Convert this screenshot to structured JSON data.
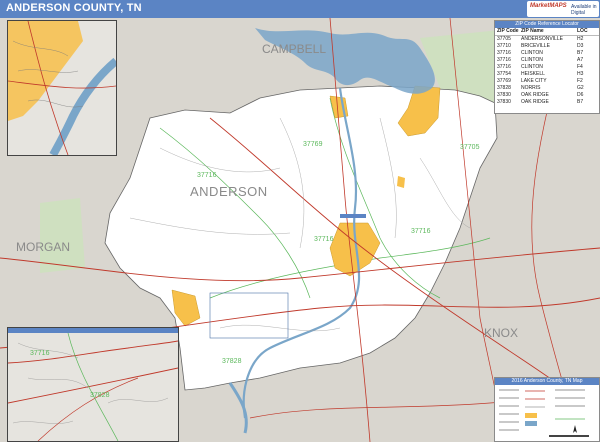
{
  "title": "ANDERSON COUNTY, TN",
  "logo": {
    "brand": "MarketMAPS",
    "sub": "Available in\nDigital"
  },
  "map_labels": {
    "county": "ANDERSON",
    "neighbors": [
      "CAMPBELL",
      "MORGAN",
      "KNOX"
    ],
    "zip_labels": [
      "37769",
      "37705",
      "37716",
      "37716",
      "37716",
      "37828"
    ],
    "inset_zip": [
      "37716",
      "37828"
    ]
  },
  "zip_table": {
    "heading": "ZIP Code Reference Locator",
    "columns": [
      "ZIP Code",
      "ZIP Name",
      "LOC"
    ],
    "rows": [
      [
        "37705",
        "ANDERSONVILLE",
        "H2"
      ],
      [
        "37710",
        "BRICEVILLE",
        "D3"
      ],
      [
        "37716",
        "CLINTON",
        "B7"
      ],
      [
        "37716",
        "CLINTON",
        "A7"
      ],
      [
        "37716",
        "CLINTON",
        "F4"
      ],
      [
        "37754",
        "HEISKELL",
        "H3"
      ],
      [
        "37769",
        "LAKE CITY",
        "F2"
      ],
      [
        "37828",
        "NORRIS",
        "G2"
      ],
      [
        "37830",
        "OAK RIDGE",
        "D6"
      ],
      [
        "37830",
        "OAK RIDGE",
        "B7"
      ]
    ]
  },
  "scale_box": {
    "heading": "2016 Anderson County, TN Map"
  },
  "colors": {
    "title_bar": "#5b84c4",
    "county_fill": "#ffffff",
    "city_fill": "#f7c04a",
    "water": "#7aa6c9",
    "background": "#d9d6cf",
    "highway": "#c0392b",
    "zip_boundary": "#5cb85c"
  }
}
